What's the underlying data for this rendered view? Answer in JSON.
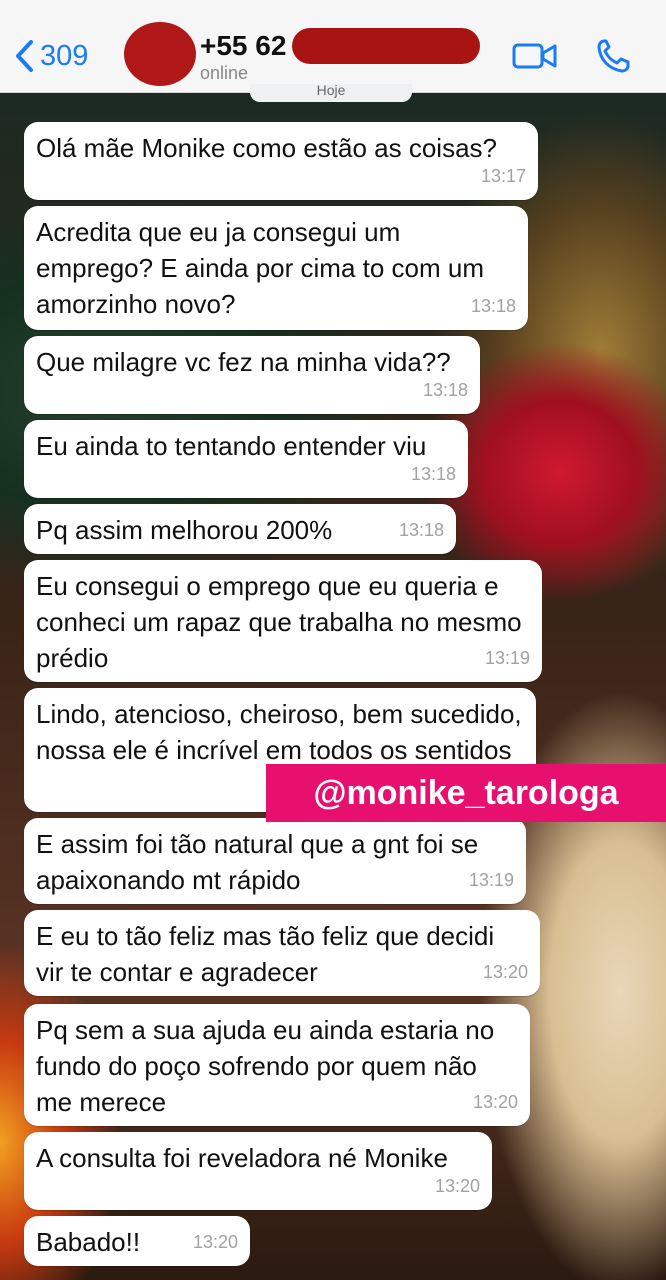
{
  "header": {
    "back_count": "309",
    "contact_number": "+55 62",
    "contact_status": "online",
    "date_label": "Hoje"
  },
  "messages": [
    {
      "text": "Olá mãe Monike como estão as coisas?",
      "time": "13:17"
    },
    {
      "text": "Acredita que eu ja consegui um emprego? E ainda por cima to com um amorzinho novo?",
      "time": "13:18"
    },
    {
      "text": "Que milagre vc fez na minha vida??",
      "time": "13:18"
    },
    {
      "text": "Eu ainda to tentando entender viu",
      "time": "13:18"
    },
    {
      "text": "Pq assim melhorou 200%",
      "time": "13:18"
    },
    {
      "text": "Eu consegui o emprego que eu queria e conheci um rapaz que trabalha no mesmo prédio",
      "time": "13:19"
    },
    {
      "text": "Lindo, atencioso, cheiroso, bem sucedido, nossa ele é incrível em todos os sentidos",
      "time": ""
    },
    {
      "text": "E assim foi tão natural que a gnt foi se apaixonando mt rápido",
      "time": "13:19"
    },
    {
      "text": "E eu to tão feliz mas tão feliz que decidi vir te contar e agradecer",
      "time": "13:20"
    },
    {
      "text": "Pq sem a sua ajuda eu ainda estaria no fundo do poço sofrendo por quem não me merece",
      "time": "13:20"
    },
    {
      "text": "A consulta foi reveladora né Monike",
      "time": "13:20"
    },
    {
      "text": "Babado!!",
      "time": "13:20"
    }
  ],
  "watermark": "@monike_tarologa",
  "colors": {
    "accent": "#1a7cf5",
    "bubble": "#ffffff",
    "watermark_bg": "#e8106e",
    "redaction": "#a81414"
  },
  "icons": {
    "back": "chevron-left-icon",
    "video": "video-camera-icon",
    "call": "phone-icon"
  }
}
